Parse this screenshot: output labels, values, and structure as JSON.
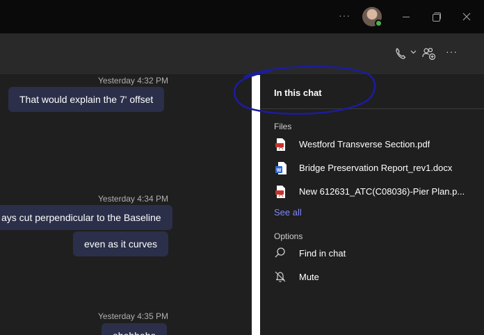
{
  "titlebar": {
    "more_glyph": "···",
    "window_controls": [
      "minimize",
      "maximize",
      "close"
    ]
  },
  "header": {
    "more_glyph": "···",
    "icons": [
      "phone-icon",
      "chevron-down-icon",
      "people-add-icon",
      "more-icon"
    ]
  },
  "chat": {
    "groups": [
      {
        "timestamp": "Yesterday 4:32 PM",
        "messages": [
          "That would explain the 7' offset"
        ]
      },
      {
        "timestamp": "Yesterday 4:34 PM",
        "messages": [
          "ays cut perpendicular to the Baseline",
          "even as it curves"
        ]
      },
      {
        "timestamp": "Yesterday 4:35 PM",
        "messages": [
          "ahahhaha"
        ]
      }
    ]
  },
  "pane": {
    "title": "In this chat",
    "files_label": "Files",
    "files": [
      {
        "name": "Westford Transverse Section.pdf",
        "type": "pdf"
      },
      {
        "name": "Bridge Preservation Report_rev1.docx",
        "type": "docx"
      },
      {
        "name": "New 612631_ATC(C08036)-Pier Plan.p...",
        "type": "pdf"
      }
    ],
    "see_all": "See all",
    "options_label": "Options",
    "options": [
      {
        "label": "Find in chat",
        "icon": "search-icon"
      },
      {
        "label": "Mute",
        "icon": "bell-off-icon"
      }
    ]
  },
  "colors": {
    "accent_link": "#7f85f5",
    "bubble": "#2b2f49",
    "annotation": "#1c1c9e",
    "status_available": "#4caf50",
    "pdf_icon": "#c4342d",
    "docx_icon": "#2b6ad6"
  }
}
